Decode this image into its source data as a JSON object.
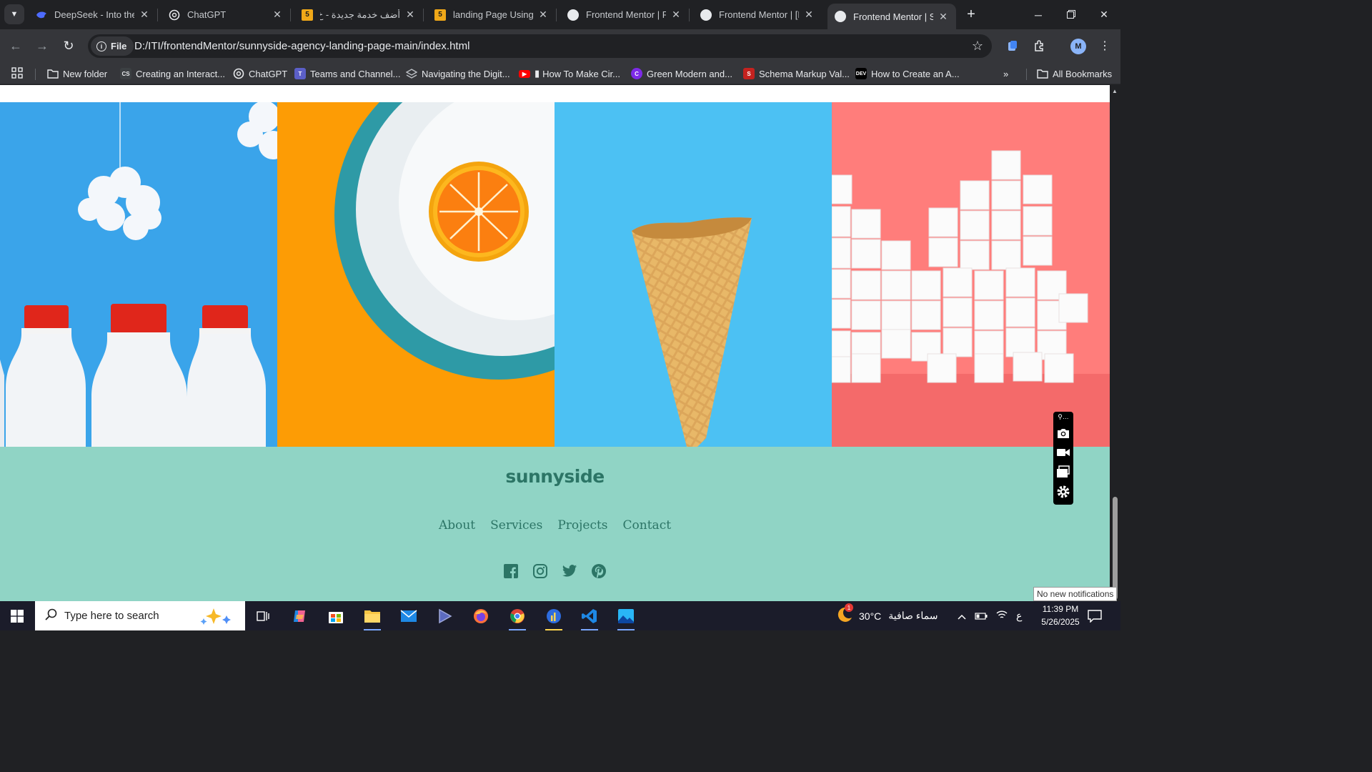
{
  "browser": {
    "tabs": [
      {
        "title": "DeepSeek - Into the Unknown",
        "favicon": "deepseek-icon",
        "active": false
      },
      {
        "title": "ChatGPT",
        "favicon": "chatgpt-icon",
        "active": false
      },
      {
        "title": "أضف خدمة جديدة - خ",
        "favicon": "html5-icon",
        "active": false
      },
      {
        "title": "landing Page Using HTML",
        "favicon": "html5-icon",
        "active": false
      },
      {
        "title": "Frontend Mentor | Fo",
        "favicon": "frontend-mentor-icon",
        "active": false
      },
      {
        "title": "Frontend Mentor | [B",
        "favicon": "frontend-mentor-icon",
        "active": false
      },
      {
        "title": "Frontend Mentor | Su",
        "favicon": "frontend-mentor-icon",
        "active": true
      }
    ],
    "address": {
      "chip_label": "File",
      "url": "D:/ITI/frontendMentor/sunnyside-agency-landing-page-main/index.html"
    },
    "profile_initial": "M",
    "bookmarks": [
      {
        "label": "New folder",
        "icon": "folder-icon"
      },
      {
        "label": "Creating an Interact...",
        "icon": "cs-icon"
      },
      {
        "label": "ChatGPT",
        "icon": "chatgpt-icon"
      },
      {
        "label": "Teams and Channel...",
        "icon": "teams-icon"
      },
      {
        "label": "Navigating the Digit...",
        "icon": "layers-icon"
      },
      {
        "label": "How To Make Cir...",
        "icon": "youtube-icon"
      },
      {
        "label": "Green Modern and...",
        "icon": "canva-icon"
      },
      {
        "label": "Schema Markup Val...",
        "icon": "schema-icon"
      },
      {
        "label": "How to Create an A...",
        "icon": "dev-icon"
      }
    ],
    "all_bookmarks_label": "All Bookmarks"
  },
  "page": {
    "gallery": [
      {
        "name": "milk-bottles",
        "color": "#3aa4ea"
      },
      {
        "name": "orange",
        "color": "#fd9c05"
      },
      {
        "name": "ice-cream-cone",
        "color": "#4cc1f3"
      },
      {
        "name": "sugar-cubes",
        "color": "#ff7d7b"
      }
    ],
    "footer": {
      "logo": "sunnyside",
      "links": [
        "About",
        "Services",
        "Projects",
        "Contact"
      ],
      "social": [
        "facebook-icon",
        "instagram-icon",
        "twitter-icon",
        "pinterest-icon"
      ],
      "bg_color": "#90d4c5",
      "text_color": "#2c7566"
    }
  },
  "notification_tip": "No new notifications",
  "taskbar": {
    "search_placeholder": "Type here to search",
    "weather": "30°C",
    "weather_desc": "سماء صافية",
    "lang": "ع",
    "time": "11:39 PM",
    "date": "5/26/2025",
    "weather_badge": "1"
  }
}
